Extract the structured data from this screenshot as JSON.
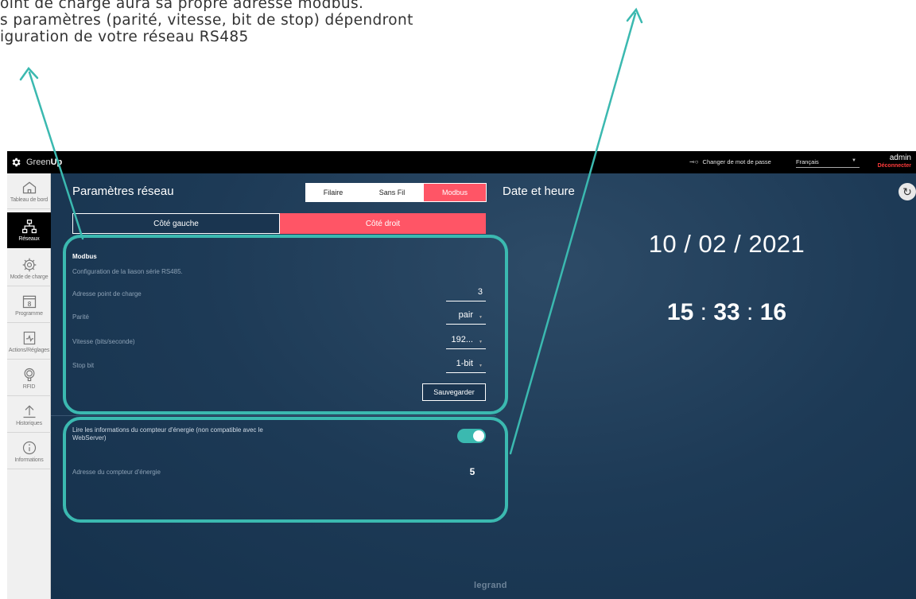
{
  "annotation": {
    "lines": [
      "oint de charge aura sa propre adresse modbus.",
      "s paramètres (parité, vitesse, bit de stop) dépendront",
      "iguration de votre réseau RS485"
    ]
  },
  "topbar": {
    "brand_prefix": "Green",
    "brand_suffix": "Up",
    "change_password": "Changer de mot de passe",
    "language": "Français",
    "user": "admin",
    "logout": "Déconnecter"
  },
  "sidebar": {
    "items": [
      {
        "label": "Tableau de bord",
        "icon": "home-icon"
      },
      {
        "label": "Réseaux",
        "icon": "network-icon"
      },
      {
        "label": "Mode de charge",
        "icon": "gear-icon"
      },
      {
        "label": "Programme",
        "icon": "calendar-icon"
      },
      {
        "label": "Actions/Réglages",
        "icon": "clipboard-icon"
      },
      {
        "label": "RFID",
        "icon": "rfid-icon"
      },
      {
        "label": "Historiques",
        "icon": "upload-icon"
      },
      {
        "label": "Informations",
        "icon": "info-icon"
      }
    ],
    "active": "Réseaux"
  },
  "network": {
    "title": "Paramètres réseau",
    "tabs": [
      "Filaire",
      "Sans Fil",
      "Modbus"
    ],
    "active_tab": "Modbus",
    "sides": [
      "Côté gauche",
      "Côté droit"
    ],
    "active_side": "Côté droit",
    "section_title": "Modbus",
    "section_subtitle": "Configuration de la liason série RS485.",
    "fields": [
      {
        "label": "Adresse point de charge",
        "value": "3"
      },
      {
        "label": "Parité",
        "value": "pair"
      },
      {
        "label": "Vitesse (bits/seconde)",
        "value": "192..."
      },
      {
        "label": "Stop bit",
        "value": "1-bit"
      }
    ],
    "save_label": "Sauvegarder",
    "meter_read_label": "Lire les informations du compteur d'énergie (non compatible avec le WebServer)",
    "meter_read_enabled": true,
    "meter_address_label": "Adresse du compteur d'énergie",
    "meter_address_value": "5"
  },
  "datetime": {
    "title": "Date et heure",
    "date": "10 / 02 / 2021",
    "hours": "15",
    "minutes": "33",
    "seconds": "16",
    "sep": ":"
  },
  "footer": {
    "logo": "legrand"
  },
  "colors": {
    "accent": "#ff5566",
    "highlight": "#3bb9b0",
    "background": "#1d3a56"
  }
}
